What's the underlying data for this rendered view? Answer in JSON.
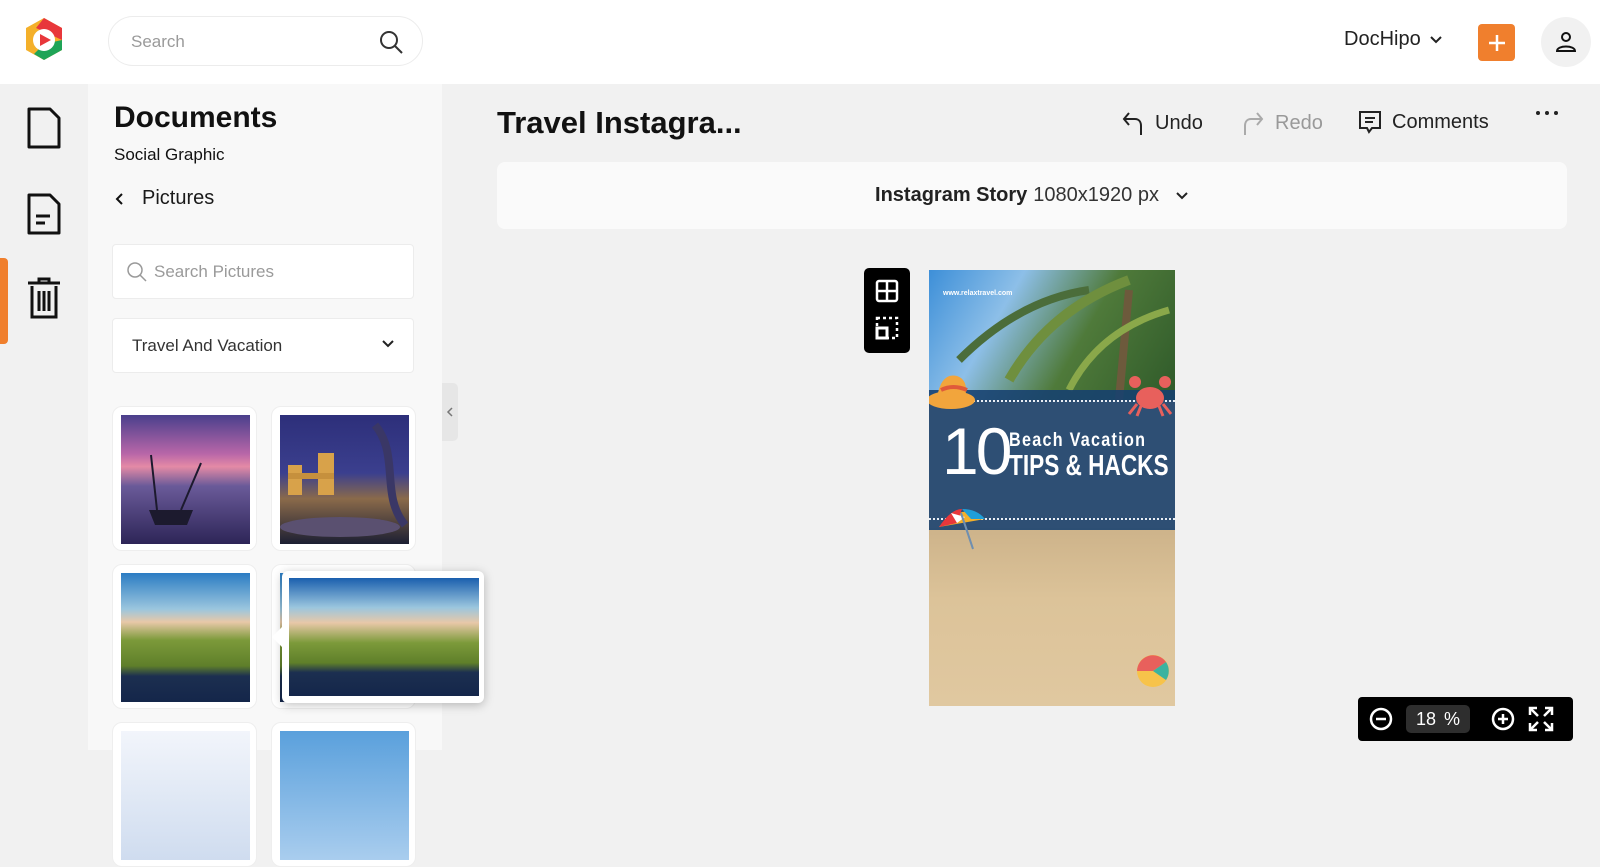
{
  "header": {
    "search_placeholder": "Search",
    "account_label": "DocHipo",
    "brand_color": "#f07f2d"
  },
  "rail": {
    "items": [
      {
        "icon": "document-icon",
        "label": "Documents"
      },
      {
        "icon": "document-text-icon",
        "label": "Social Graphic",
        "active": true
      },
      {
        "icon": "trash-icon",
        "label": "Trash"
      }
    ]
  },
  "panel": {
    "title": "Documents",
    "subtitle": "Social Graphic",
    "back_label": "Pictures",
    "search_placeholder": "Search Pictures",
    "category": "Travel And Vacation",
    "thumbnails": [
      {
        "name": "boat-at-sunset"
      },
      {
        "name": "tower-bridge-night"
      },
      {
        "name": "cyclist-hills-road"
      },
      {
        "name": "cyclist-hills-road-2"
      },
      {
        "name": "sky-1"
      },
      {
        "name": "sky-2"
      }
    ]
  },
  "editor": {
    "doc_title": "Travel Instagra...",
    "undo_label": "Undo",
    "redo_label": "Redo",
    "comments_label": "Comments",
    "format_name": "Instagram Story",
    "format_size": "1080x1920 px",
    "zoom_value": "18",
    "zoom_unit": "%"
  },
  "design": {
    "url": "www.relaxtravel.com",
    "number": "10",
    "line1": "Beach Vacation",
    "line2": "TIPS & HACKS"
  }
}
